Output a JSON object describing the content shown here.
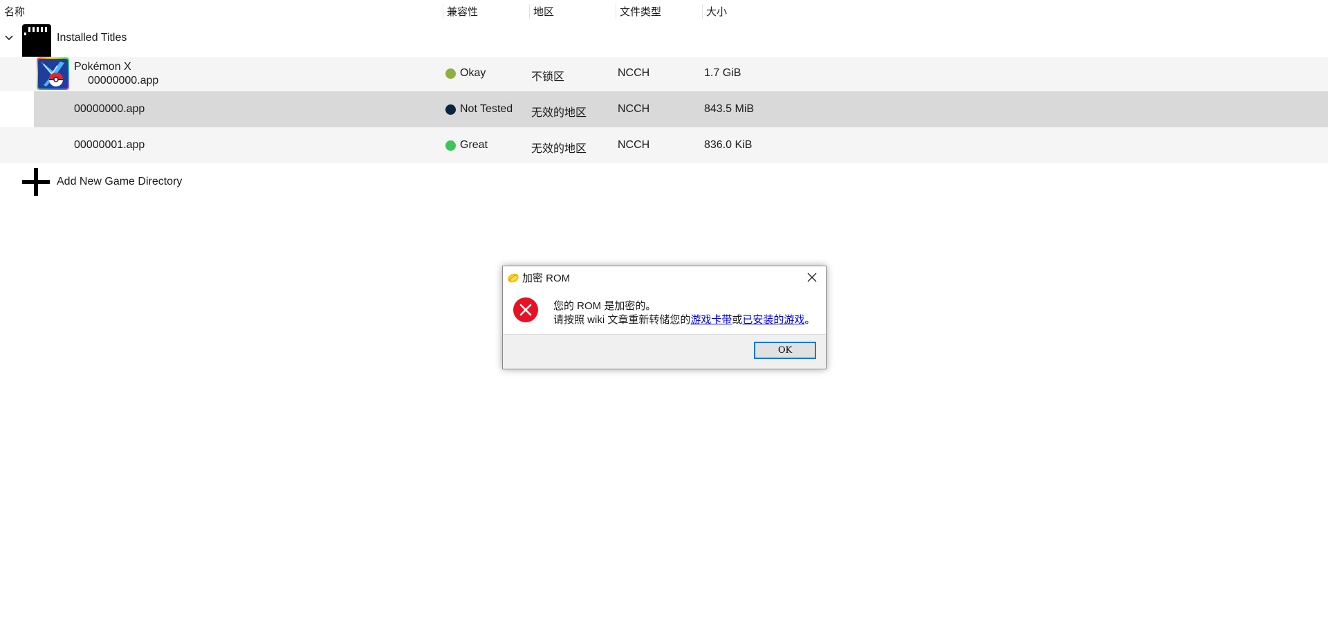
{
  "header": {
    "name": "名称",
    "compat": "兼容性",
    "region": "地区",
    "filetype": "文件类型",
    "size": "大小"
  },
  "group": {
    "label": "Installed Titles",
    "icon": "sd-card-icon",
    "expand_icon": "chevron-down-icon"
  },
  "rows": [
    {
      "title": "Pokémon X",
      "subtitle": "00000000.app",
      "compat": "Okay",
      "compat_color": "#8fb040",
      "region": "不锁区",
      "filetype": "NCCH",
      "size": "1.7 GiB"
    },
    {
      "title": "00000000.app",
      "compat": "Not Tested",
      "compat_color": "#0a2540",
      "region": "无效的地区",
      "filetype": "NCCH",
      "size": "843.5 MiB"
    },
    {
      "title": "00000001.app",
      "compat": "Great",
      "compat_color": "#3ec45a",
      "region": "无效的地区",
      "filetype": "NCCH",
      "size": "836.0 KiB"
    }
  ],
  "add_dir": {
    "label": "Add New Game Directory",
    "icon": "plus-icon"
  },
  "dialog": {
    "title": "加密 ROM",
    "message_line1": "您的 ROM 是加密的。",
    "message_line2_prefix": "请按照 wiki 文章重新转储您的",
    "link1": "游戏卡带",
    "middle": "或",
    "link2": "已安装的游戏",
    "suffix": "。",
    "ok_label": "OK",
    "error_color": "#e81123",
    "accent_color": "#0078d7"
  }
}
